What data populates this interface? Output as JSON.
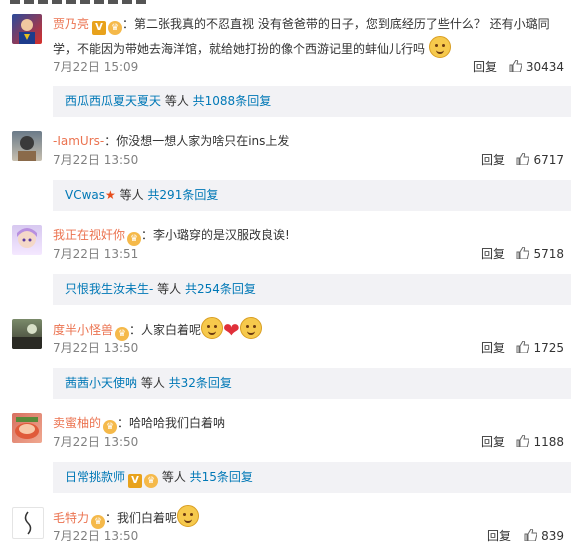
{
  "comments": [
    {
      "username": "贾乃亮",
      "text1": "：第二张我真的不忍直视    没有爸爸带的日子，您到底经历了些什么？  还有小璐同",
      "text2": "学，不能因为带她去海洋馆，就给她打扮的像个西游记里的蚌仙儿行吗",
      "date": "7月22日 15:09",
      "reply": "回复",
      "likes": "30434",
      "sub_user": "西瓜西瓜夏天夏天",
      "sub_mid": " 等人 ",
      "sub_link": "共1088条回复"
    },
    {
      "username": "-IamUrs-",
      "text": "：你没想一想人家为啥只在ins上发",
      "date": "7月22日 13:50",
      "reply": "回复",
      "likes": "6717",
      "sub_user": "VCwas",
      "sub_mid": " 等人 ",
      "sub_link": "共291条回复"
    },
    {
      "username": "我正在视奸你",
      "text": "：李小璐穿的是汉服改良诶!",
      "date": "7月22日 13:51",
      "reply": "回复",
      "likes": "5718",
      "sub_user": "只恨我生汝未生-",
      "sub_mid": " 等人 ",
      "sub_link": "共254条回复"
    },
    {
      "username": "度半小怪兽",
      "text": "：人家白着呢",
      "date": "7月22日 13:50",
      "reply": "回复",
      "likes": "1725",
      "sub_user": "茜茜小天使呐",
      "sub_mid": " 等人 ",
      "sub_link": "共32条回复"
    },
    {
      "username": "卖蜜柚的",
      "text": "：哈哈哈我们白着呐",
      "date": "7月22日 13:50",
      "reply": "回复",
      "likes": "1188",
      "sub_user": "日常挑款师",
      "sub_mid": " 等人 ",
      "sub_link": "共15条回复"
    },
    {
      "username": "毛特力",
      "text": "：我们白着呢",
      "date": "7月22日 13:50",
      "reply": "回复",
      "likes": "839"
    }
  ],
  "colors": {
    "username": "#eb7350",
    "link": "#0078b6",
    "sub_bg": "#f2f2f5"
  },
  "icons": {
    "vip": "vip-badge-icon",
    "like": "thumb-up-icon"
  }
}
